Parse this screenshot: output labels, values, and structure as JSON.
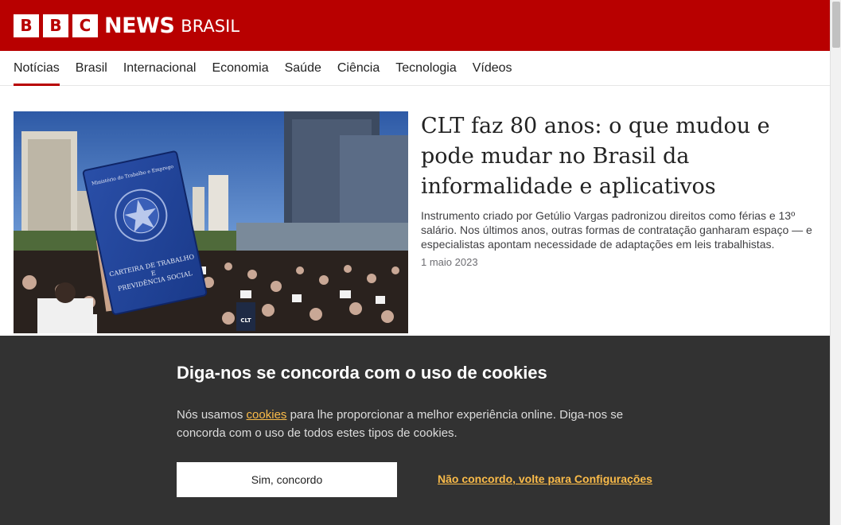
{
  "header": {
    "logo_letters": [
      "B",
      "B",
      "C"
    ],
    "brand": "NEWS",
    "edition": "BRASIL",
    "brand_color": "#b80000"
  },
  "nav": {
    "items": [
      {
        "label": "Notícias",
        "active": true
      },
      {
        "label": "Brasil",
        "active": false
      },
      {
        "label": "Internacional",
        "active": false
      },
      {
        "label": "Economia",
        "active": false
      },
      {
        "label": "Saúde",
        "active": false
      },
      {
        "label": "Ciência",
        "active": false
      },
      {
        "label": "Tecnologia",
        "active": false
      },
      {
        "label": "Vídeos",
        "active": false
      }
    ]
  },
  "lead_story": {
    "image_icon": "photo-work-card-protest",
    "image_card_text": [
      "Ministério do Trabalho e Emprego",
      "CARTEIRA DE TRABALHO",
      "E",
      "PREVIDÊNCIA SOCIAL"
    ],
    "image_sign_text": "CLT",
    "headline": "CLT faz 80 anos: o que mudou e pode mudar no Brasil da informalidade e aplicativos",
    "summary": "Instrumento criado por Getúlio Vargas padronizou direitos como férias e 13º salário. Nos últimos anos, outras formas de contratação ganharam espaço — e especialistas apontam necessidade de adaptações em leis trabalhistas.",
    "date": "1 maio 2023"
  },
  "cookie_banner": {
    "title": "Diga-nos se concorda com o uso de cookies",
    "text_before": "Nós usamos ",
    "link_label": "cookies",
    "text_after": " para lhe proporcionar a melhor experiência online. Diga-nos se concorda com o uso de todos estes tipos de cookies.",
    "accept_label": "Sim, concordo",
    "decline_label": "Não concordo, volte para Configurações",
    "background_color": "#323232",
    "link_color": "#fabb49"
  }
}
